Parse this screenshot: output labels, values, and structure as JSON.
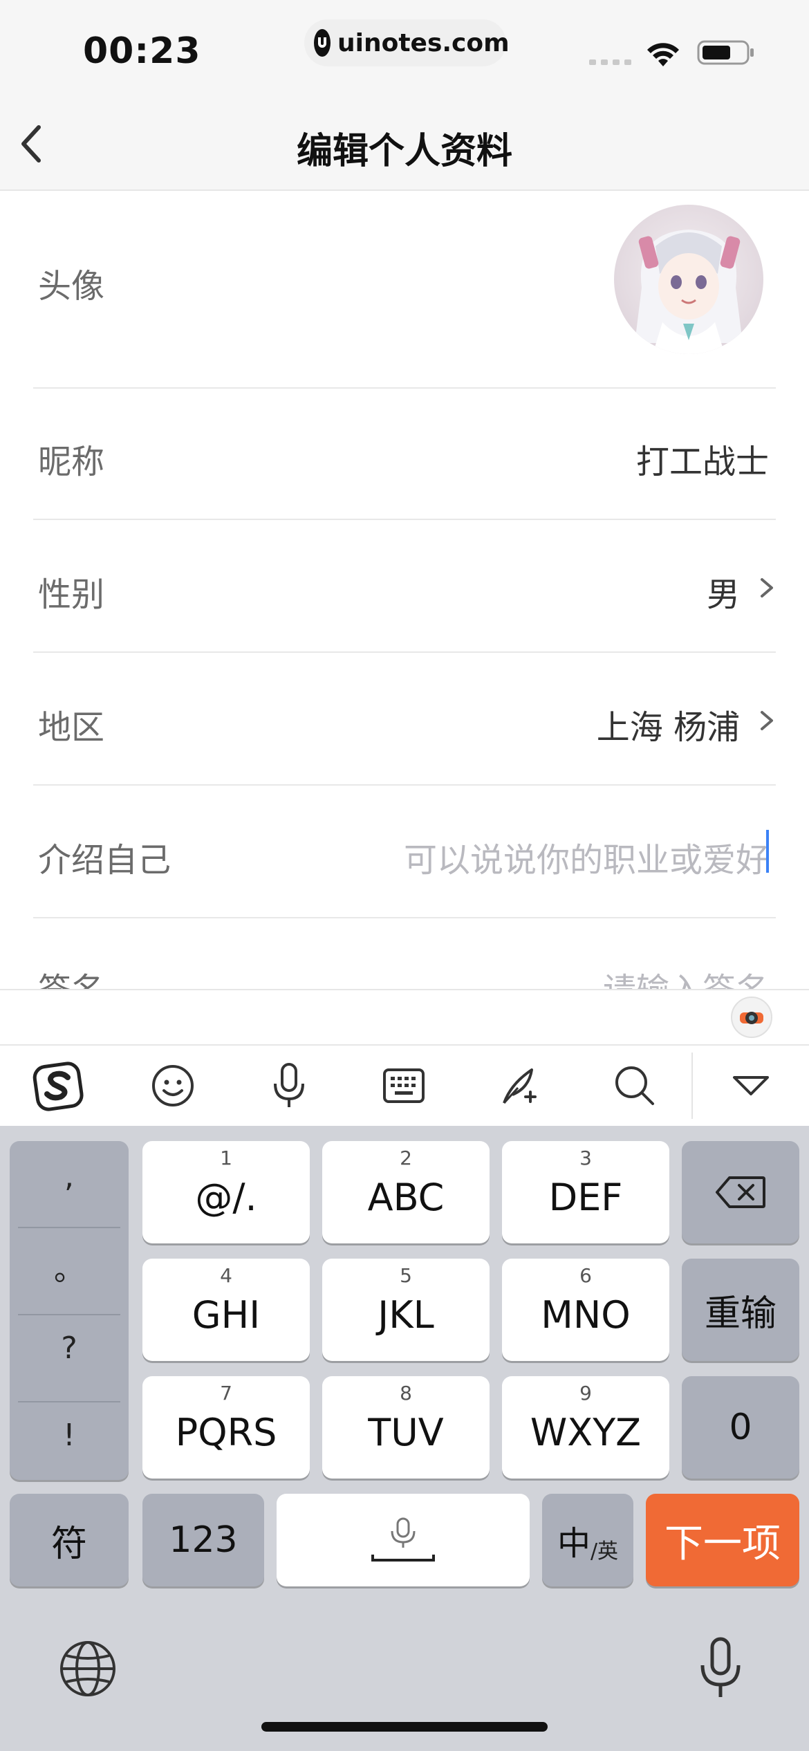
{
  "status_bar": {
    "time": "00:23",
    "url": "uinotes.com"
  },
  "nav": {
    "title": "编辑个人资料"
  },
  "form": {
    "avatar_label": "头像",
    "nickname_label": "昵称",
    "nickname_value": "打工战士",
    "gender_label": "性别",
    "gender_value": "男",
    "region_label": "地区",
    "region_value": "上海 杨浦",
    "intro_label": "介绍自己",
    "intro_placeholder": "可以说说你的职业或爱好",
    "signature_label": "签名",
    "signature_placeholder": "请输入签名"
  },
  "keyboard": {
    "punct": [
      ",",
      "。",
      "?",
      "!"
    ],
    "keys": [
      {
        "num": "1",
        "label": "@/."
      },
      {
        "num": "2",
        "label": "ABC"
      },
      {
        "num": "3",
        "label": "DEF"
      },
      {
        "num": "4",
        "label": "GHI"
      },
      {
        "num": "5",
        "label": "JKL"
      },
      {
        "num": "6",
        "label": "MNO"
      },
      {
        "num": "7",
        "label": "PQRS"
      },
      {
        "num": "8",
        "label": "TUV"
      },
      {
        "num": "9",
        "label": "WXYZ"
      }
    ],
    "reenter": "重输",
    "zero": "0",
    "symbols": "符",
    "numbers": "123",
    "lang_main": "中",
    "lang_sub": "/英",
    "next": "下一项"
  },
  "colors": {
    "accent": "#f06a35",
    "caret": "#3b82f6"
  },
  "icons": [
    "back-chevron-icon",
    "sogou-logo-icon",
    "emoji-icon",
    "microphone-icon",
    "keyboard-icon",
    "handwriting-icon",
    "search-icon",
    "collapse-keyboard-icon",
    "backspace-icon",
    "globe-icon",
    "dictation-icon"
  ]
}
